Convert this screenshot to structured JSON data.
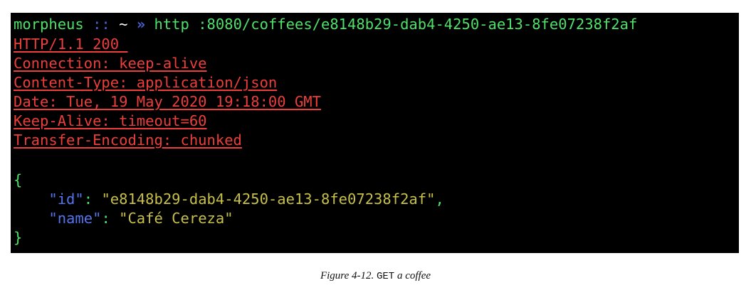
{
  "terminal": {
    "prompt": {
      "user": "morpheus",
      "separator": "::",
      "path": "~",
      "chevron": "»",
      "command": "http :8080/coffees/e8148b29-dab4-4250-ae13-8fe07238f2af"
    },
    "response_headers": [
      "HTTP/1.1 200 ",
      "Connection: keep-alive",
      "Content-Type: application/json",
      "Date: Tue, 19 May 2020 19:18:00 GMT",
      "Keep-Alive: timeout=60",
      "Transfer-Encoding: chunked"
    ],
    "body": {
      "open_brace": "{",
      "close_brace": "}",
      "fields": [
        {
          "key": "id",
          "value": "\"e8148b29-dab4-4250-ae13-8fe07238f2af\"",
          "trailing": ","
        },
        {
          "key": "name",
          "value": "\"Café Cereza\"",
          "trailing": ""
        }
      ]
    },
    "colors": {
      "background": "#000000",
      "prompt_green": "#4fe06b",
      "prompt_blue": "#4a62d9",
      "header_red": "#ec3e3b",
      "json_key_blue": "#5575f0",
      "json_string_yellow": "#c6c04a"
    }
  },
  "caption": {
    "prefix": "Figure 4-12. ",
    "code": "GET",
    "suffix": " a coffee"
  }
}
